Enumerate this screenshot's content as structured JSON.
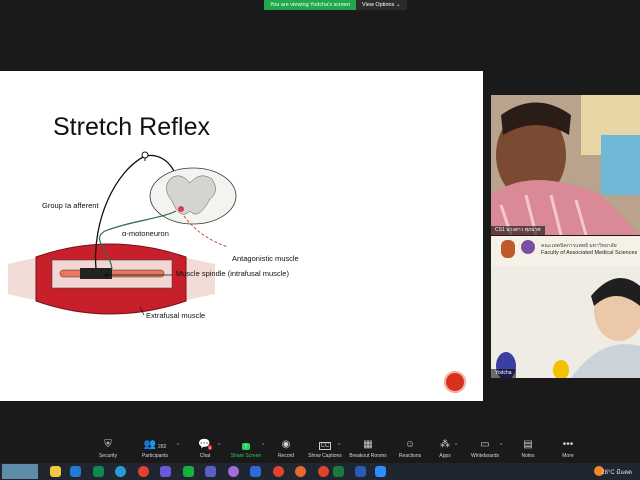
{
  "banner": {
    "message": "You are viewing Yodcha's screen",
    "options_label": "View Options"
  },
  "slide": {
    "title": "Stretch Reflex",
    "labels": {
      "afferent": "Group Ia afferent",
      "motoneuron": "α-motoneuron",
      "antagonist": "Antagonistic muscle",
      "spindle": "Muscle spindle (intrafusal muscle)",
      "extrafusal": "Extrafusal muscle"
    }
  },
  "videos": [
    {
      "name": "CS1 นางสาว ศุภมาศ"
    },
    {
      "name": "Yodcha",
      "banner_text": "คณะเทคนิคการแพทย์ มหาวิทยาลัย",
      "banner_sub": "Faculty of Associated Medical Sciences"
    }
  ],
  "toolbar": {
    "items": [
      {
        "label": "Security",
        "icon": "shield-icon"
      },
      {
        "label": "Participants",
        "icon": "participants-icon",
        "count": "282"
      },
      {
        "label": "Chat",
        "icon": "chat-icon",
        "badge": "6"
      },
      {
        "label": "Share Screen",
        "icon": "share-screen-icon"
      },
      {
        "label": "Record",
        "icon": "record-icon"
      },
      {
        "label": "Show Captions",
        "icon": "captions-icon"
      },
      {
        "label": "Breakout Rooms",
        "icon": "breakout-icon"
      },
      {
        "label": "Reactions",
        "icon": "reactions-icon"
      },
      {
        "label": "Apps",
        "icon": "apps-icon"
      },
      {
        "label": "Whiteboards",
        "icon": "whiteboard-icon"
      },
      {
        "label": "Notes",
        "icon": "notes-icon"
      },
      {
        "label": "More",
        "icon": "more-icon"
      }
    ]
  },
  "taskbar": {
    "weather": "28°C",
    "weather_desc": "มีแดด"
  },
  "colors": {
    "accent_green": "#2ad15c",
    "muscle_red": "#c8202b",
    "slide_bg": "#ffffff"
  }
}
